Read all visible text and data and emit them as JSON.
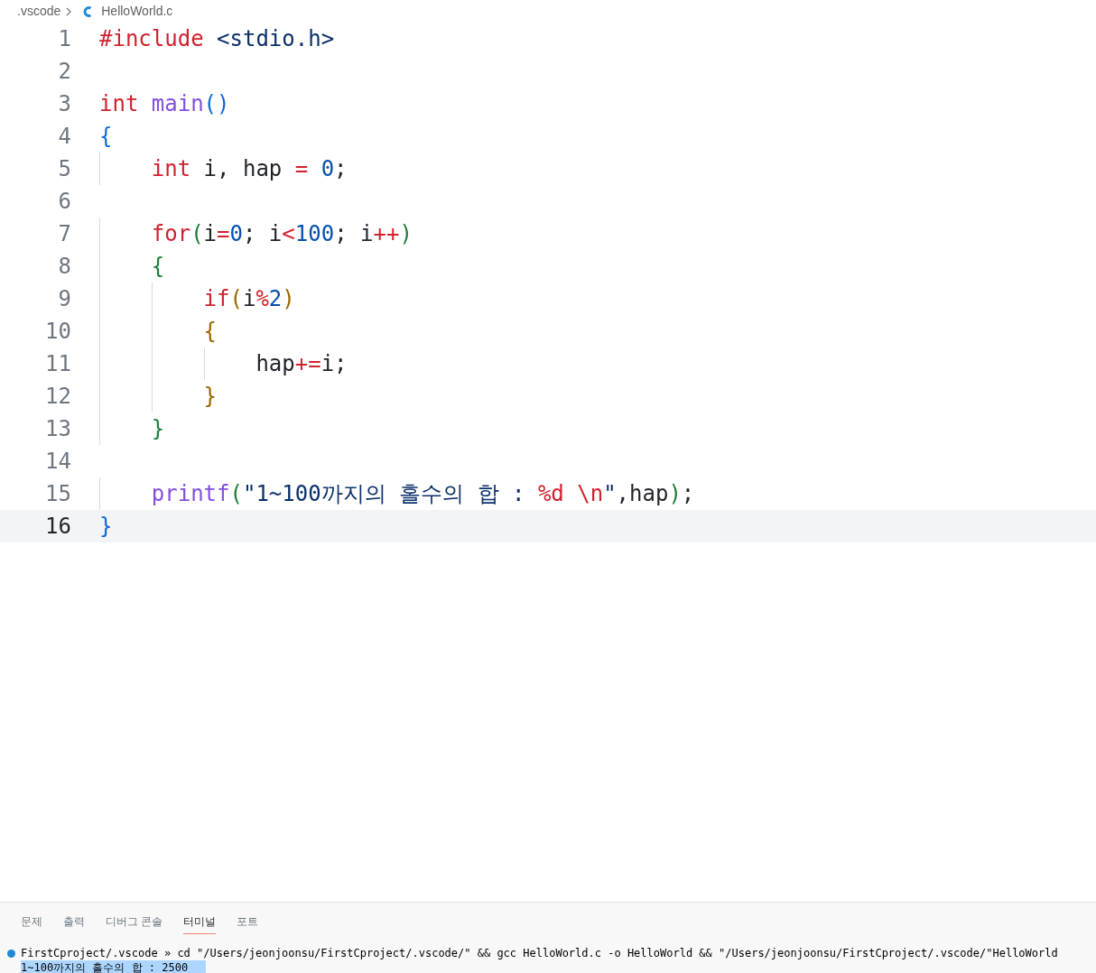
{
  "breadcrumb": {
    "folder": ".vscode",
    "file": "HelloWorld.c"
  },
  "editor": {
    "lines": [
      {
        "number": "1",
        "current": false,
        "tokens": [
          {
            "text": "#include",
            "kind": "keyword"
          },
          {
            "text": " <stdio.h>",
            "kind": "string"
          }
        ]
      },
      {
        "number": "2",
        "current": false
      },
      {
        "number": "3",
        "current": false,
        "tokens": [
          {
            "text": "int",
            "kind": "keyword"
          },
          {
            "text": " main",
            "kind": "function"
          },
          {
            "text": "()",
            "kind": "bracket1"
          }
        ]
      },
      {
        "number": "4",
        "current": false,
        "tokens": [
          {
            "text": "{",
            "kind": "bracket1"
          }
        ]
      },
      {
        "number": "5",
        "current": false,
        "tokens": [
          {
            "text": "    int",
            "kind": "keyword"
          },
          {
            "text": " i, hap ",
            "kind": "plain"
          },
          {
            "text": "=",
            "kind": "operator"
          },
          {
            "text": " 0",
            "kind": "number"
          },
          {
            "text": ";",
            "kind": "plain"
          }
        ]
      },
      {
        "number": "6",
        "current": false
      },
      {
        "number": "7",
        "current": false,
        "tokens": [
          {
            "text": "    for",
            "kind": "keyword"
          },
          {
            "text": "(",
            "kind": "bracket2"
          },
          {
            "text": "i",
            "kind": "plain"
          },
          {
            "text": "=",
            "kind": "operator"
          },
          {
            "text": "0",
            "kind": "number"
          },
          {
            "text": "; i",
            "kind": "plain"
          },
          {
            "text": "<",
            "kind": "operator"
          },
          {
            "text": "100",
            "kind": "number"
          },
          {
            "text": "; i",
            "kind": "plain"
          },
          {
            "text": "++",
            "kind": "operator"
          },
          {
            "text": ")",
            "kind": "bracket2"
          }
        ]
      },
      {
        "number": "8",
        "current": false,
        "tokens": [
          {
            "text": "    {",
            "kind": "bracket2"
          }
        ]
      },
      {
        "number": "9",
        "current": false,
        "tokens": [
          {
            "text": "        if",
            "kind": "keyword"
          },
          {
            "text": "(",
            "kind": "bracket3"
          },
          {
            "text": "i",
            "kind": "plain"
          },
          {
            "text": "%",
            "kind": "operator"
          },
          {
            "text": "2",
            "kind": "number"
          },
          {
            "text": ")",
            "kind": "bracket3"
          }
        ]
      },
      {
        "number": "10",
        "current": false,
        "tokens": [
          {
            "text": "        {",
            "kind": "bracket3"
          }
        ]
      },
      {
        "number": "11",
        "current": false,
        "tokens": [
          {
            "text": "            hap",
            "kind": "plain"
          },
          {
            "text": "+=",
            "kind": "operator"
          },
          {
            "text": "i;",
            "kind": "plain"
          }
        ]
      },
      {
        "number": "12",
        "current": false,
        "tokens": [
          {
            "text": "        }",
            "kind": "bracket3"
          }
        ]
      },
      {
        "number": "13",
        "current": false,
        "tokens": [
          {
            "text": "    }",
            "kind": "bracket2"
          }
        ]
      },
      {
        "number": "14",
        "current": false
      },
      {
        "number": "15",
        "current": false,
        "tokens": [
          {
            "text": "    printf",
            "kind": "function"
          },
          {
            "text": "(",
            "kind": "bracket2"
          },
          {
            "text": "\"1~100까지의 홀수의 합 : ",
            "kind": "string"
          },
          {
            "text": "%d \\n",
            "kind": "escape"
          },
          {
            "text": "\"",
            "kind": "string"
          },
          {
            "text": ",hap",
            "kind": "plain"
          },
          {
            "text": ")",
            "kind": "bracket2"
          },
          {
            "text": ";",
            "kind": "plain"
          }
        ]
      },
      {
        "number": "16",
        "current": true,
        "tokens": [
          {
            "text": "}",
            "kind": "bracket1"
          }
        ]
      }
    ]
  },
  "panel": {
    "tabs": [
      {
        "label": "문제",
        "selected": false
      },
      {
        "label": "출력",
        "selected": false
      },
      {
        "label": "디버그 콘솔",
        "selected": false
      },
      {
        "label": "터미널",
        "selected": true
      },
      {
        "label": "포트",
        "selected": false
      }
    ],
    "terminal": [
      {
        "text": "FirstCproject/.vscode » cd \"/Users/jeonjoonsu/FirstCproject/.vscode/\" && gcc HelloWorld.c -o HelloWorld && \"/Users/jeonjoonsu/FirstCproject/.vscode/\"HelloWorld",
        "kind": "command",
        "highlighted": false
      },
      {
        "text": "1~100까지의 홀수의 합 : 2500",
        "kind": "output",
        "highlighted": true
      }
    ]
  }
}
